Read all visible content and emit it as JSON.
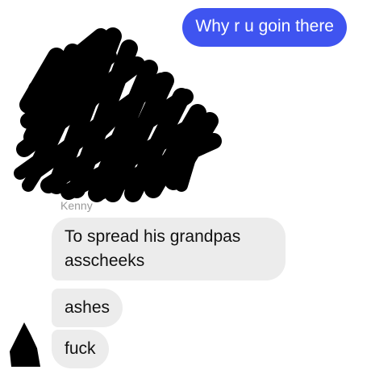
{
  "outgoing": {
    "text": "Why r u goin there"
  },
  "incoming": {
    "sender": "Kenny",
    "messages": [
      {
        "lines": [
          "To spread his grandpas",
          "asscheeks"
        ]
      },
      {
        "lines": [
          "ashes"
        ]
      },
      {
        "lines": [
          "fuck"
        ]
      }
    ]
  },
  "colors": {
    "outgoing_bubble": "#3f54f0",
    "incoming_bubble": "#ececec",
    "redaction": "#000000"
  }
}
